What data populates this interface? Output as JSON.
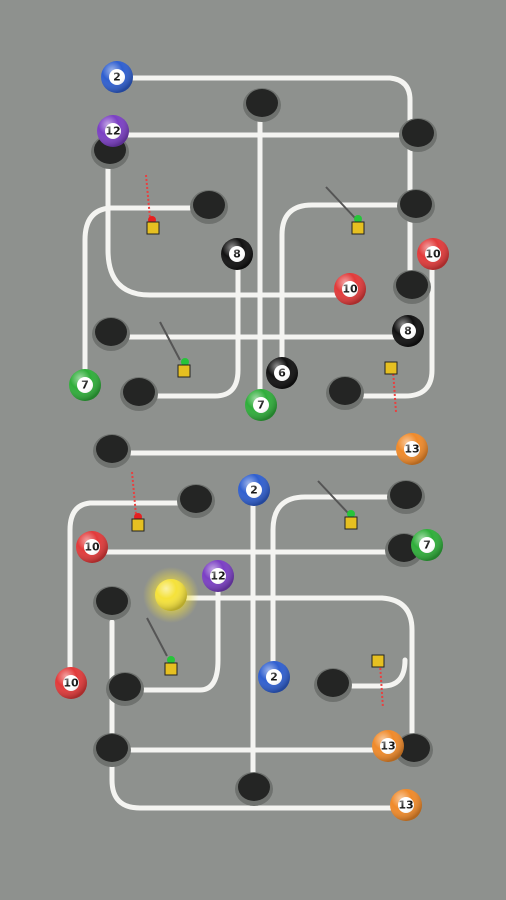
{
  "game": {
    "ball_colors": {
      "2": "#2f5fd0",
      "7": "#2fae3a",
      "8": "#111111",
      "10": "#e23a3a",
      "12": "#7b3fc4",
      "13": "#f08a2a"
    },
    "cue_ball_color": "#f5e23a",
    "balls": [
      {
        "label": "2",
        "color": "2"
      },
      {
        "label": "12",
        "color": "12"
      },
      {
        "label": "8",
        "color": "8"
      },
      {
        "label": "10",
        "color": "10"
      },
      {
        "label": "10",
        "color": "10"
      },
      {
        "label": "8",
        "color": "8"
      },
      {
        "label": "7",
        "color": "7"
      },
      {
        "label": "6",
        "color": "8"
      },
      {
        "label": "7",
        "color": "7"
      },
      {
        "label": "13",
        "color": "13"
      },
      {
        "label": "2",
        "color": "2"
      },
      {
        "label": "10",
        "color": "10"
      },
      {
        "label": "7",
        "color": "7"
      },
      {
        "label": "12",
        "color": "12"
      },
      {
        "label": "10",
        "color": "10"
      },
      {
        "label": "2",
        "color": "2"
      },
      {
        "label": "13",
        "color": "13"
      },
      {
        "label": "13",
        "color": "13"
      }
    ]
  }
}
